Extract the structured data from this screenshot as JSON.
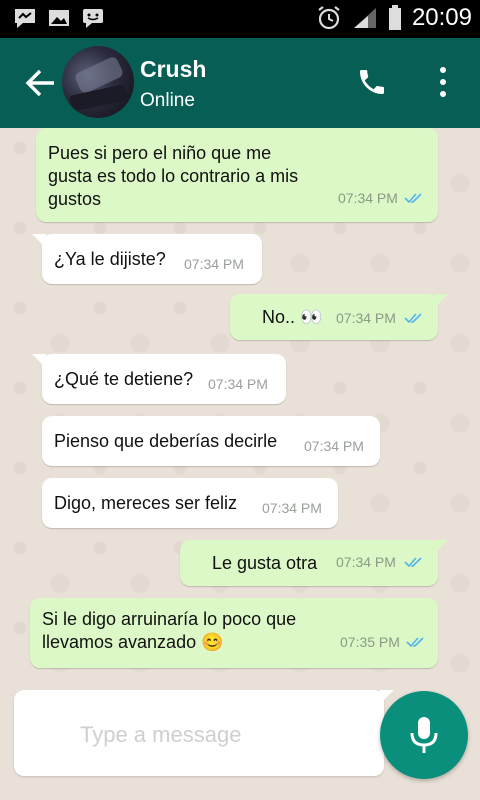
{
  "status_bar": {
    "time": "20:09"
  },
  "contact": {
    "name": "Crush",
    "status": "Online"
  },
  "messages": [
    {
      "direction": "out",
      "lines": [
        "Pues si pero el niño que me",
        "gusta es todo lo contrario a mis",
        "gustos"
      ],
      "time": "07:34 PM",
      "read": true
    },
    {
      "direction": "in",
      "lines": [
        "¿Ya le dijiste?"
      ],
      "time": "07:34 PM"
    },
    {
      "direction": "out",
      "lines": [
        "No.. 👀"
      ],
      "time": "07:34 PM",
      "read": true
    },
    {
      "direction": "in",
      "lines": [
        "¿Qué te detiene?"
      ],
      "time": "07:34 PM"
    },
    {
      "direction": "in",
      "lines": [
        "Pienso que deberías decirle"
      ],
      "time": "07:34 PM"
    },
    {
      "direction": "in",
      "lines": [
        "Digo, mereces ser feliz"
      ],
      "time": "07:34 PM"
    },
    {
      "direction": "out",
      "lines": [
        "Le gusta otra"
      ],
      "time": "07:34 PM",
      "read": true
    },
    {
      "direction": "out",
      "lines": [
        "Si le digo arruinaría lo poco que",
        "llevamos avanzado 😊"
      ],
      "time": "07:35 PM",
      "read": true
    }
  ],
  "composer": {
    "placeholder": "Type a message"
  },
  "colors": {
    "header": "#075e54",
    "outgoing": "#dcf8c6",
    "incoming": "#ffffff",
    "read_tick": "#4fb3f0",
    "mic": "#0b8f7d"
  }
}
